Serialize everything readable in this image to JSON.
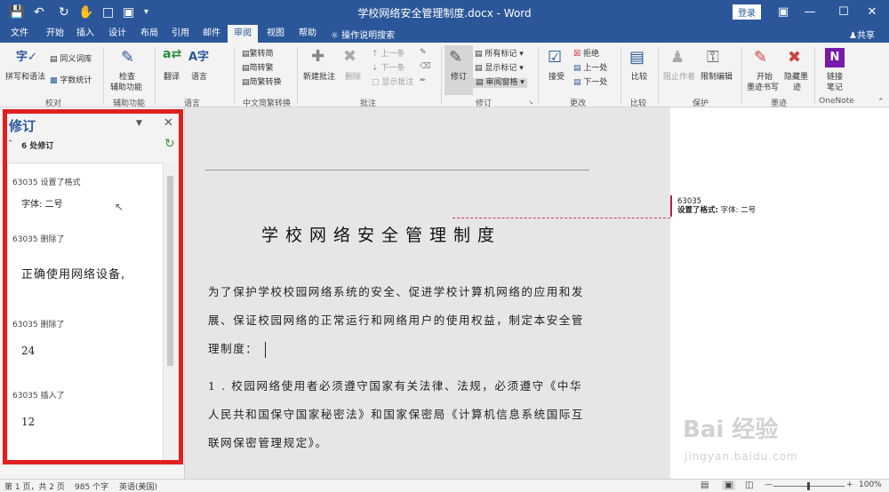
{
  "titlebar": {
    "title": "学校网络安全管理制度.docx - Word",
    "login": "登录"
  },
  "tabs": [
    "文件",
    "开始",
    "插入",
    "设计",
    "布局",
    "引用",
    "邮件",
    "审阅",
    "视图",
    "帮助"
  ],
  "active_tab": "审阅",
  "tell_me": "操作说明搜索",
  "share": "共享",
  "ribbon": {
    "proofing": {
      "spell": "拼写和语法",
      "thesaurus": "同义词库",
      "wordcount": "字数统计",
      "label": "校对"
    },
    "accessibility": {
      "check": "检查",
      "check2": "辅助功能",
      "label": "辅助功能"
    },
    "language": {
      "translate": "翻译",
      "lang": "语言",
      "label": "语言"
    },
    "chinese": {
      "t2s": "繁转简",
      "s2t": "简转繁",
      "convert": "简繁转换",
      "label": "中文简繁转换"
    },
    "comments": {
      "new": "新建批注",
      "delete": "删除",
      "prev": "上一条",
      "next": "下一条",
      "show": "显示批注",
      "label": "批注"
    },
    "tracking": {
      "track": "修订",
      "allmarkup": "所有标记",
      "showmarkup": "显示标记",
      "pane": "审阅窗格",
      "label": "修订"
    },
    "changes": {
      "accept": "接受",
      "reject": "拒绝",
      "prev": "上一处",
      "next": "下一处",
      "label": "更改"
    },
    "compare": {
      "compare": "比较",
      "label": "比较"
    },
    "protect": {
      "block": "阻止作者",
      "restrict": "限制编辑",
      "label": "保护"
    },
    "ink": {
      "start": "开始",
      "start2": "墨迹书写",
      "hide": "隐藏墨",
      "hide2": "迹",
      "label": "墨迹"
    },
    "onenote": {
      "link": "链接",
      "link2": "笔记",
      "label": "OneNote"
    }
  },
  "pane": {
    "title": "修订",
    "count": "6 处修订",
    "revisions": [
      {
        "head": "63035  设置了格式",
        "body": "字体: 二号"
      },
      {
        "head": "63035  删除了",
        "body": "正确使用网络设备,"
      },
      {
        "head": "63035  删除了",
        "body": "24"
      },
      {
        "head": "63035  插入了",
        "body": "12"
      }
    ]
  },
  "document": {
    "title": "学校网络安全管理制度",
    "para1_l1": "为了保护学校校园网络系统的安全、促进学校计算机网络的应用和发",
    "para1_l2": "展、保证校园网络的正常运行和网络用户的使用权益，制定本安全管",
    "para1_l3": "理制度：",
    "para2_l1": "1 . 校园网络使用者必须遵守国家有关法律、法规，必须遵守《中华",
    "para2_l2": "人民共和国保守国家秘密法》和国家保密局《计算机信息系统国际互",
    "para2_l3": "联网保密管理规定》。"
  },
  "balloon": {
    "author": "63035",
    "label": "设置了格式:",
    "value": "字体: 二号"
  },
  "status": {
    "page": "第 1 页，共 2 页",
    "words": "985 个字",
    "lang": "英语(美国)",
    "zoom": "100%"
  },
  "watermark": {
    "main": "Bai 经验",
    "sub": "jingyan.baidu.com"
  },
  "colors": {
    "brand": "#2b579a",
    "highlight": "#e02020",
    "markup": "#b02050"
  }
}
